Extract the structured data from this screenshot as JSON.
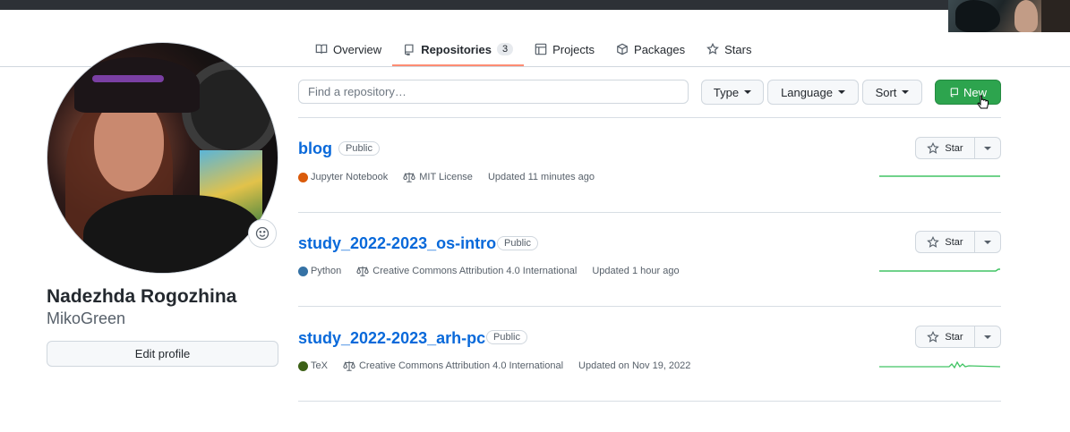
{
  "nav": {
    "tabs": [
      {
        "label": "Overview",
        "icon": "book-icon"
      },
      {
        "label": "Repositories",
        "icon": "repo-icon",
        "count": "3",
        "active": true
      },
      {
        "label": "Projects",
        "icon": "table-icon"
      },
      {
        "label": "Packages",
        "icon": "package-icon"
      },
      {
        "label": "Stars",
        "icon": "star-icon"
      }
    ]
  },
  "profile": {
    "full_name": "Nadezhda Rogozhina",
    "username": "MikoGreen",
    "edit_label": "Edit profile"
  },
  "toolbar": {
    "search_placeholder": "Find a repository…",
    "type_label": "Type",
    "language_label": "Language",
    "sort_label": "Sort",
    "new_label": "New"
  },
  "repos": [
    {
      "name": "blog",
      "visibility": "Public",
      "language": "Jupyter Notebook",
      "language_color": "#DA5B0B",
      "license": "MIT License",
      "updated": "Updated 11 minutes ago",
      "star_label": "Star"
    },
    {
      "name": "study_2022-2023_os-intro",
      "visibility": "Public",
      "language": "Python",
      "language_color": "#3572A5",
      "license": "Creative Commons Attribution 4.0 International",
      "updated": "Updated 1 hour ago",
      "star_label": "Star"
    },
    {
      "name": "study_2022-2023_arh-pc",
      "visibility": "Public",
      "language": "TeX",
      "language_color": "#3D6117",
      "license": "Creative Commons Attribution 4.0 International",
      "updated": "Updated on Nov 19, 2022",
      "star_label": "Star"
    }
  ],
  "colors": {
    "link": "#0969da",
    "primary_button": "#2da44e",
    "active_tab_underline": "#fd8c73",
    "sparkline": "#40c463"
  }
}
